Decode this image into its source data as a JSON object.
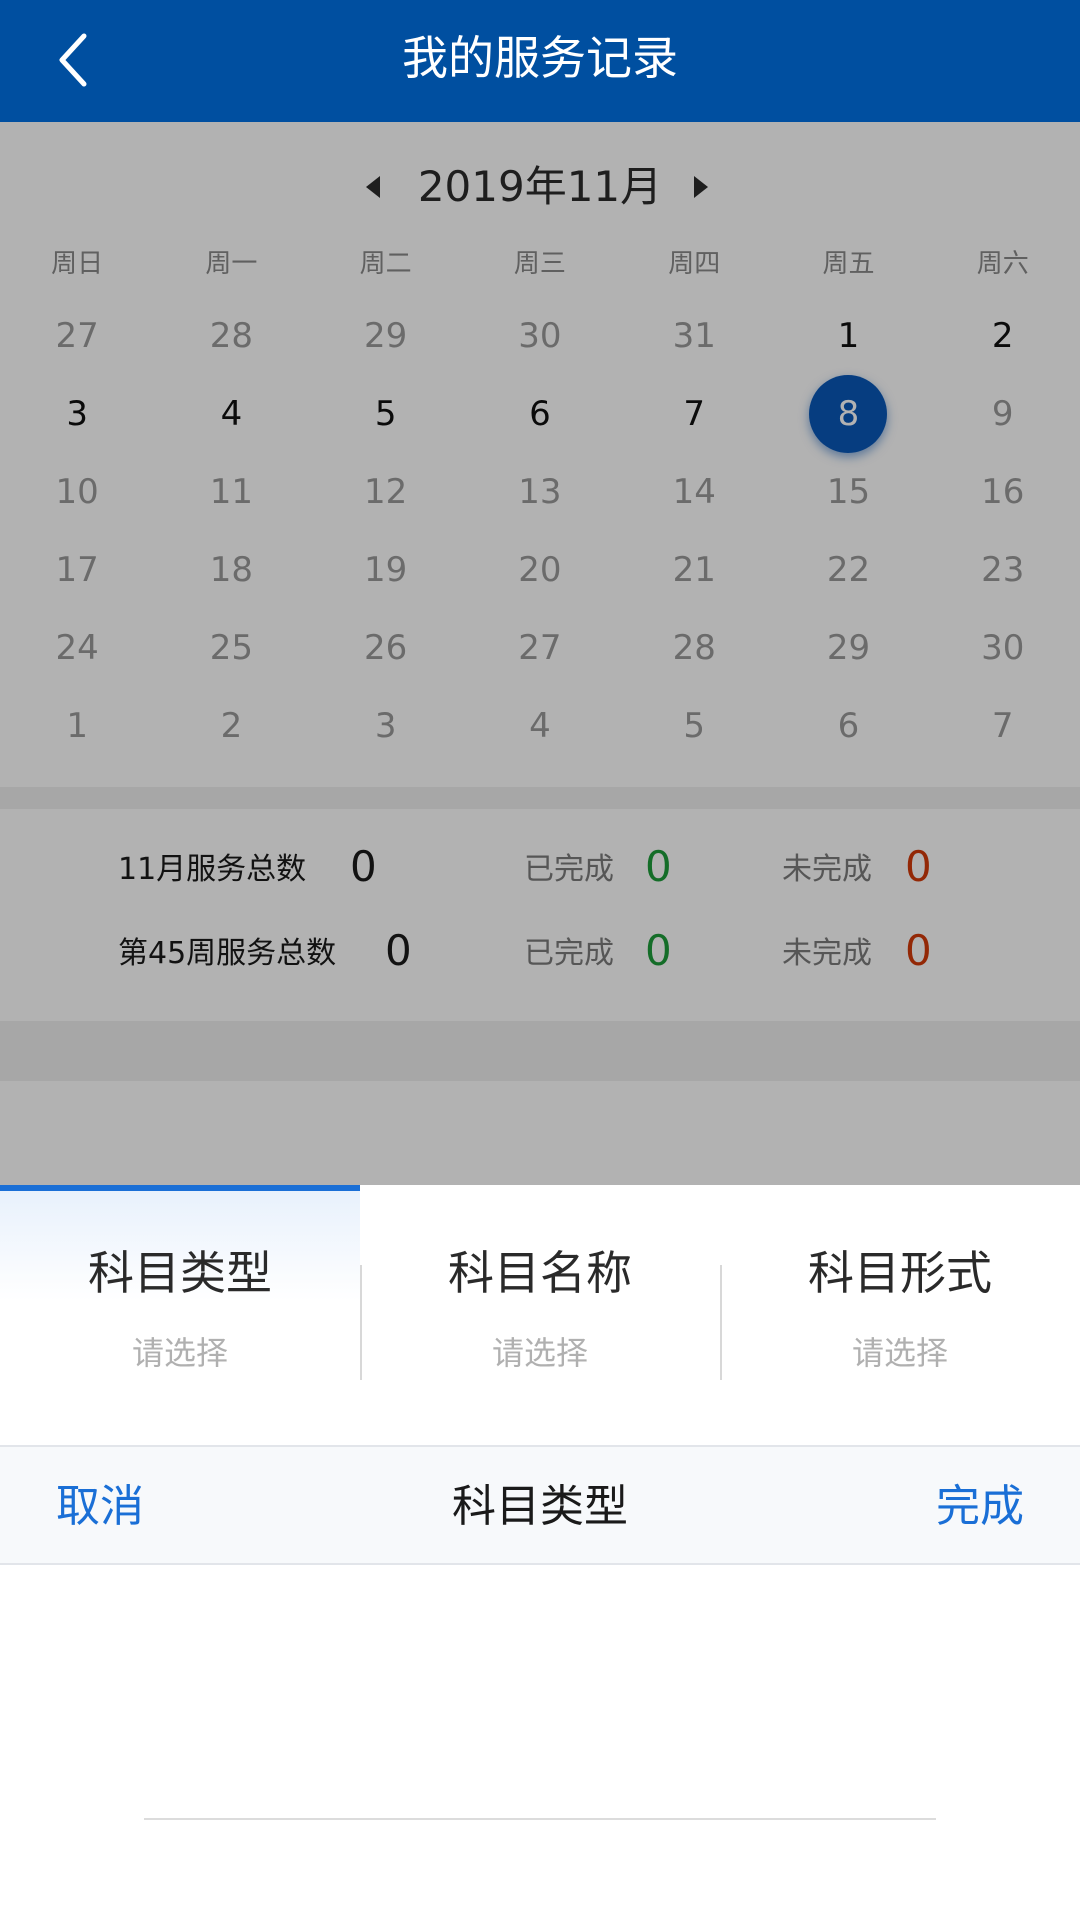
{
  "header": {
    "title": "我的服务记录",
    "back_icon": "chevron-left-icon"
  },
  "calendar": {
    "month_label": "2019年11月",
    "weekdays": [
      "周日",
      "周一",
      "周二",
      "周三",
      "周四",
      "周五",
      "周六"
    ],
    "weeks": [
      [
        "27",
        "28",
        "29",
        "30",
        "31",
        "1",
        "2"
      ],
      [
        "3",
        "4",
        "5",
        "6",
        "7",
        "8",
        "9"
      ],
      [
        "10",
        "11",
        "12",
        "13",
        "14",
        "15",
        "16"
      ],
      [
        "17",
        "18",
        "19",
        "20",
        "21",
        "22",
        "23"
      ],
      [
        "24",
        "25",
        "26",
        "27",
        "28",
        "29",
        "30"
      ],
      [
        "1",
        "2",
        "3",
        "4",
        "5",
        "6",
        "7"
      ]
    ],
    "selected_day": "8",
    "accent_color": "#0a58b8"
  },
  "stats": {
    "month": {
      "label": "11月服务总数",
      "total": "0",
      "done_label": "已完成",
      "done": "0",
      "undone_label": "未完成",
      "undone": "0"
    },
    "week": {
      "label": "第45周服务总数",
      "total": "0",
      "done_label": "已完成",
      "done": "0",
      "undone_label": "未完成",
      "undone": "0"
    }
  },
  "sheet": {
    "tabs": [
      {
        "title": "科目类型",
        "hint": "请选择"
      },
      {
        "title": "科目名称",
        "hint": "请选择"
      },
      {
        "title": "科目形式",
        "hint": "请选择"
      }
    ],
    "toolbar": {
      "cancel": "取消",
      "title": "科目类型",
      "done": "完成"
    }
  }
}
